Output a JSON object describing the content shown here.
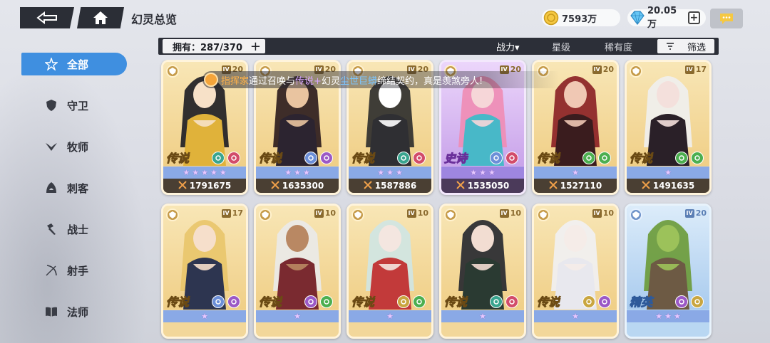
{
  "header": {
    "title": "幻灵总览",
    "gold": "7593万",
    "gems": "20.05万",
    "gems_plus": "+"
  },
  "filterbar": {
    "owned": "拥有：287/370",
    "owned_plus": "+",
    "sort": [
      "战力▾",
      "星级",
      "稀有度"
    ],
    "filter": "筛选"
  },
  "sidebar": {
    "items": [
      {
        "label": "全部",
        "icon": "star-outline-icon",
        "active": true
      },
      {
        "label": "守卫",
        "icon": "shield-icon"
      },
      {
        "label": "牧师",
        "icon": "wings-icon"
      },
      {
        "label": "刺客",
        "icon": "hood-icon"
      },
      {
        "label": "战士",
        "icon": "hammer-icon"
      },
      {
        "label": "射手",
        "icon": "bow-icon"
      },
      {
        "label": "法师",
        "icon": "book-icon"
      }
    ]
  },
  "notice": {
    "part1": "指挥家",
    "part2": "通过召唤与",
    "part3": "传说+",
    "part4": "幻灵",
    "part5": "尘世巨蟒",
    "part6": "缔结契约，真是羡煞旁人!"
  },
  "cards": [
    {
      "rarity": "传说",
      "tier": "IV",
      "level": "20",
      "stars": 5,
      "power": "1791675",
      "type": "legend",
      "elems": [
        "#3aa58f",
        "#d24c6a"
      ]
    },
    {
      "rarity": "传说",
      "tier": "IV",
      "level": "20",
      "stars": 3,
      "power": "1635300",
      "type": "legend",
      "elems": [
        "#6c8fd8",
        "#9b59c6"
      ]
    },
    {
      "rarity": "传说",
      "tier": "IV",
      "level": "20",
      "stars": 3,
      "power": "1587886",
      "type": "legend",
      "elems": [
        "#3aa58f",
        "#d24c6a"
      ]
    },
    {
      "rarity": "史诗",
      "tier": "IV",
      "level": "20",
      "stars": 3,
      "power": "1535050",
      "type": "epic",
      "elems": [
        "#6c8fd8",
        "#d24c6a"
      ]
    },
    {
      "rarity": "传说",
      "tier": "IV",
      "level": "20",
      "stars": 1,
      "power": "1527110",
      "type": "legend",
      "elems": [
        "#4caf50",
        "#4caf50"
      ]
    },
    {
      "rarity": "传说",
      "tier": "IV",
      "level": "17",
      "stars": 1,
      "power": "1491635",
      "type": "legend",
      "elems": [
        "#4caf50",
        "#4caf50"
      ]
    },
    {
      "rarity": "传说",
      "tier": "IV",
      "level": "17",
      "stars": 1,
      "power": "",
      "type": "legend",
      "elems": [
        "#6c8fd8",
        "#9b59c6"
      ]
    },
    {
      "rarity": "传说",
      "tier": "IV",
      "level": "10",
      "stars": 1,
      "power": "",
      "type": "legend",
      "elems": [
        "#9b59c6",
        "#4caf50"
      ]
    },
    {
      "rarity": "传说",
      "tier": "IV",
      "level": "10",
      "stars": 1,
      "power": "",
      "type": "legend",
      "elems": [
        "#c9a640",
        "#4caf50"
      ]
    },
    {
      "rarity": "传说",
      "tier": "IV",
      "level": "10",
      "stars": 1,
      "power": "",
      "type": "legend",
      "elems": [
        "#3aa58f",
        "#d24c6a"
      ]
    },
    {
      "rarity": "传说",
      "tier": "IV",
      "level": "10",
      "stars": 1,
      "power": "",
      "type": "legend",
      "elems": [
        "#c9a640",
        "#9b59c6"
      ]
    },
    {
      "rarity": "精英",
      "tier": "IV",
      "level": "20",
      "stars": 3,
      "power": "",
      "type": "elite",
      "elems": [
        "#9b59c6",
        "#c9a640"
      ]
    }
  ],
  "colors": {
    "accent": "#3f8fe0",
    "dark_bar": "#2c2f38",
    "legend_card": "#f2d79a",
    "epic_card": "#d6b8ef",
    "elite_card": "#b9d7f2"
  }
}
